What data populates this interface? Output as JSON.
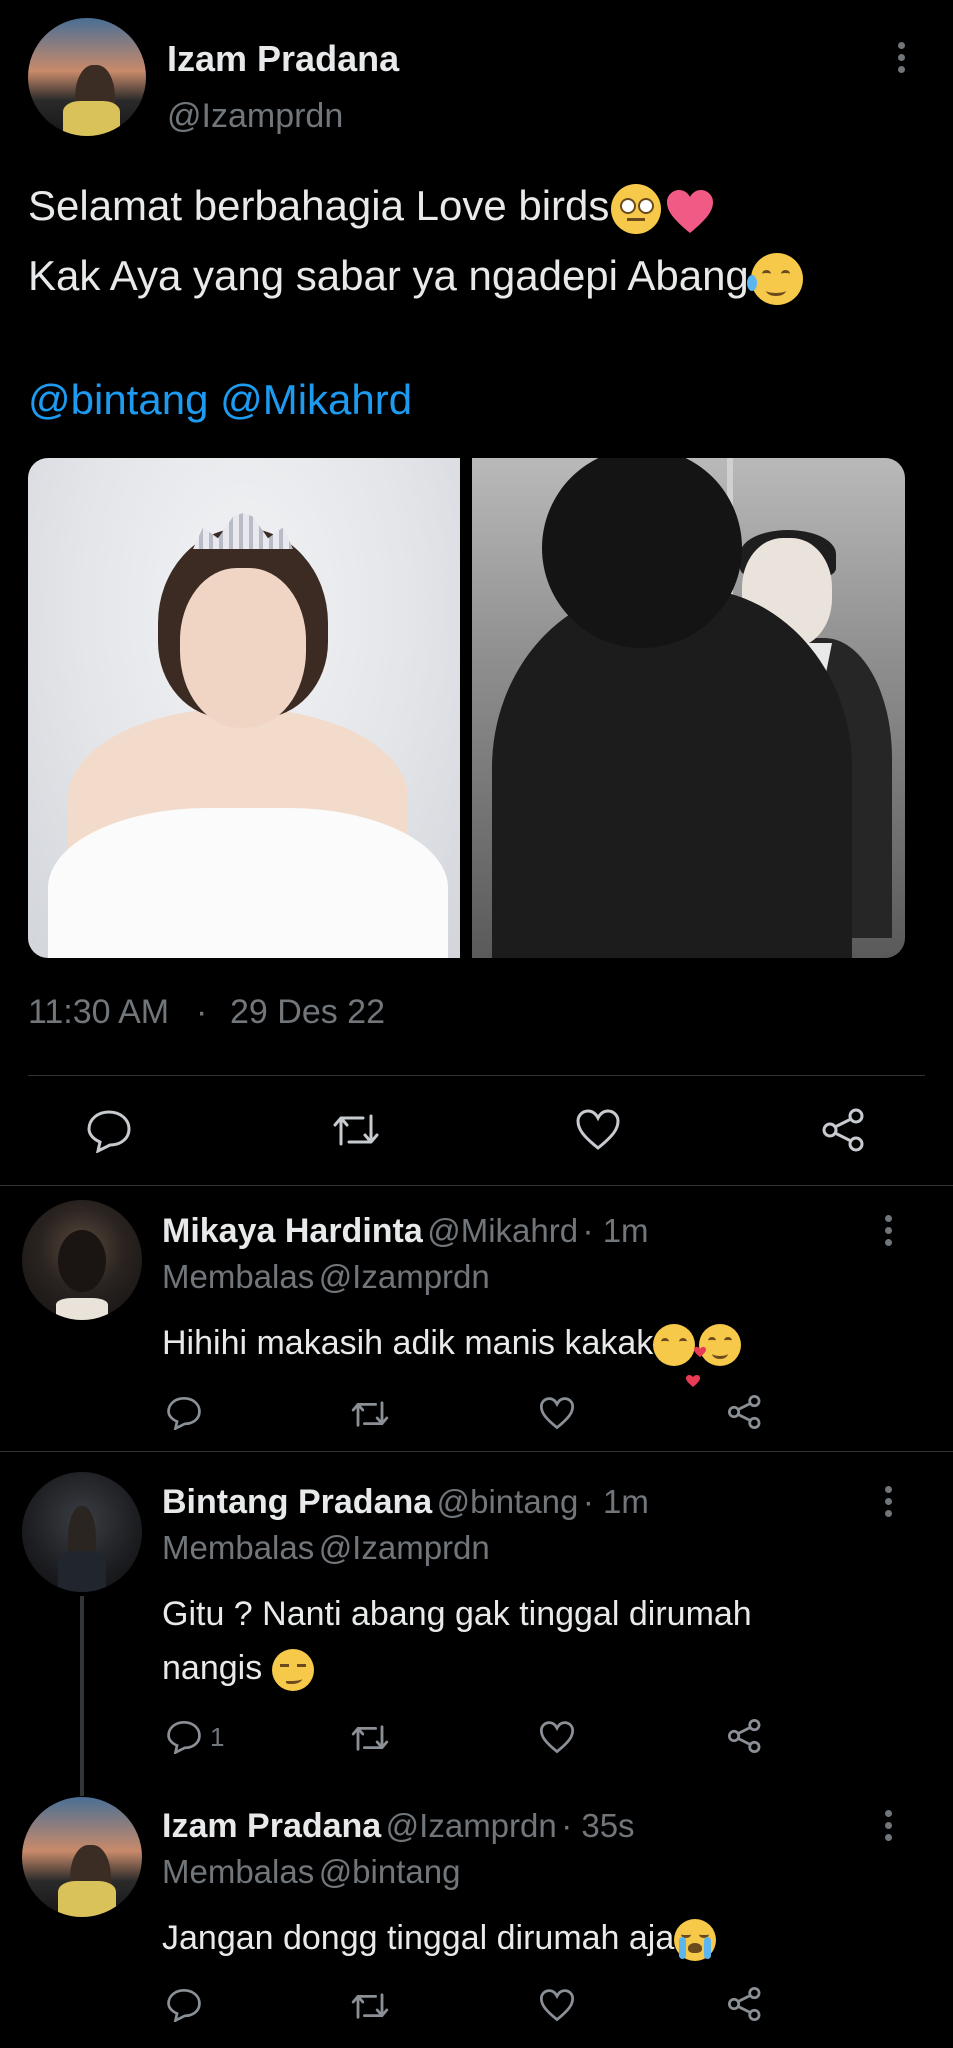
{
  "main_tweet": {
    "author_name": "Izam Pradana",
    "author_handle": "@Izamprdn",
    "text_line1": "Selamat berbahagia Love birds",
    "text_line2": "Kak Aya yang sabar ya ngadepi  Abang",
    "mentions": "@bintang @Mikahrd",
    "time": "11:30 AM",
    "dot": "·",
    "date": "29 Des 22"
  },
  "replies": [
    {
      "name": "Mikaya Hardinta",
      "handle": "@Mikahrd",
      "age": "· 1m",
      "replying_prefix": "Membalas",
      "replying_to": "@Izamprdn",
      "text": "Hihihi makasih adik manis kakak",
      "reply_count": ""
    },
    {
      "name": "Bintang Pradana",
      "handle": "@bintang",
      "age": "· 1m",
      "replying_prefix": "Membalas",
      "replying_to": "@Izamprdn",
      "text_line1": "Gitu ? Nanti abang gak tinggal dirumah",
      "text_line2": "nangis",
      "reply_count": "1"
    },
    {
      "name": "Izam Pradana",
      "handle": "@Izamprdn",
      "age": "· 35s",
      "replying_prefix": "Membalas",
      "replying_to": "@bintang",
      "text": "Jangan dongg tinggal dirumah aja",
      "reply_count": ""
    }
  ],
  "colors": {
    "background": "#000000",
    "text": "#e7e9ea",
    "secondary": "#71767b",
    "link": "#1d9bf0"
  },
  "icons": [
    "more-icon",
    "reply-icon",
    "retweet-icon",
    "like-icon",
    "share-icon"
  ]
}
